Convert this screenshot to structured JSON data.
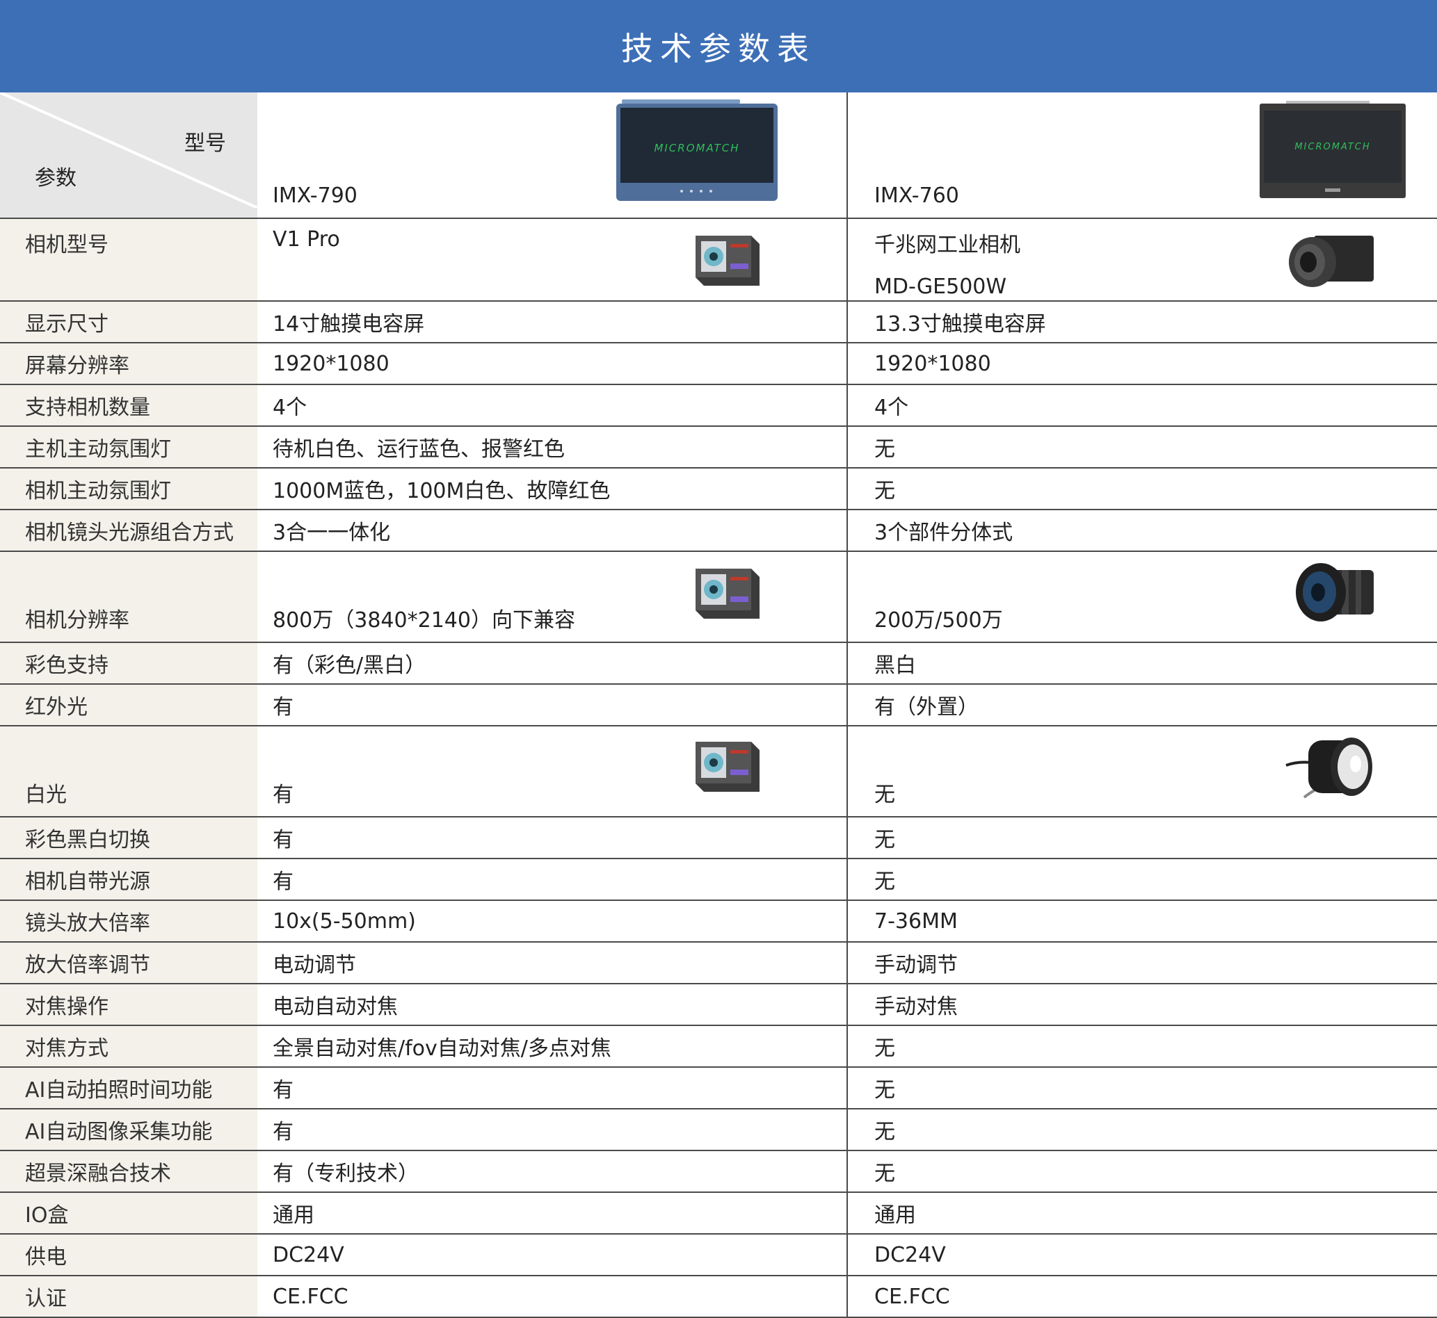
{
  "title": "技术参数表",
  "header": {
    "corner_top": "型号",
    "corner_bottom": "参数",
    "model_a": "IMX-790",
    "model_b": "IMX-760",
    "brand_logo": "MICROMATCH",
    "icons": [
      "monitor-imx790-icon",
      "monitor-imx760-icon"
    ]
  },
  "rows": [
    {
      "label": "相机型号",
      "a": "V1 Pro",
      "b": "千兆网工业相机",
      "b2": "MD-GE500W"
    },
    {
      "label": "显示尺寸",
      "a": "14寸触摸电容屏",
      "b": "13.3寸触摸电容屏"
    },
    {
      "label": "屏幕分辨率",
      "a": "1920*1080",
      "b": "1920*1080"
    },
    {
      "label": "支持相机数量",
      "a": "4个",
      "b": "4个"
    },
    {
      "label": "主机主动氛围灯",
      "a": "待机白色、运行蓝色、报警红色",
      "b": "无"
    },
    {
      "label": "相机主动氛围灯",
      "a": "1000M蓝色，100M白色、故障红色",
      "b": "无"
    },
    {
      "label": "相机镜头光源组合方式",
      "a": "3合一一体化",
      "b": "3个部件分体式"
    },
    {
      "label": "相机分辨率",
      "a": "800万（3840*2140）向下兼容",
      "b": "200万/500万"
    },
    {
      "label": "彩色支持",
      "a": "有（彩色/黑白）",
      "b": "黑白"
    },
    {
      "label": "红外光",
      "a": "有",
      "b": "有（外置）"
    },
    {
      "label": "白光",
      "a": "有",
      "b": "无"
    },
    {
      "label": "彩色黑白切换",
      "a": "有",
      "b": "无"
    },
    {
      "label": "相机自带光源",
      "a": "有",
      "b": "无"
    },
    {
      "label": "镜头放大倍率",
      "a": "10x(5-50mm)",
      "b": "7-36MM"
    },
    {
      "label": "放大倍率调节",
      "a": "电动调节",
      "b": "手动调节"
    },
    {
      "label": "对焦操作",
      "a": "电动自动对焦",
      "b": "手动对焦"
    },
    {
      "label": "对焦方式",
      "a": "全景自动对焦/fov自动对焦/多点对焦",
      "b": "无"
    },
    {
      "label": "AI自动拍照时间功能",
      "a": "有",
      "b": "无"
    },
    {
      "label": "AI自动图像采集功能",
      "a": "有",
      "b": "无"
    },
    {
      "label": "超景深融合技术",
      "a": "有（专利技术）",
      "b": "无"
    },
    {
      "label": "IO盒",
      "a": "通用",
      "b": "通用"
    },
    {
      "label": "供电",
      "a": "DC24V",
      "b": "DC24V"
    },
    {
      "label": "认证",
      "a": "CE.FCC",
      "b": "CE.FCC"
    }
  ]
}
